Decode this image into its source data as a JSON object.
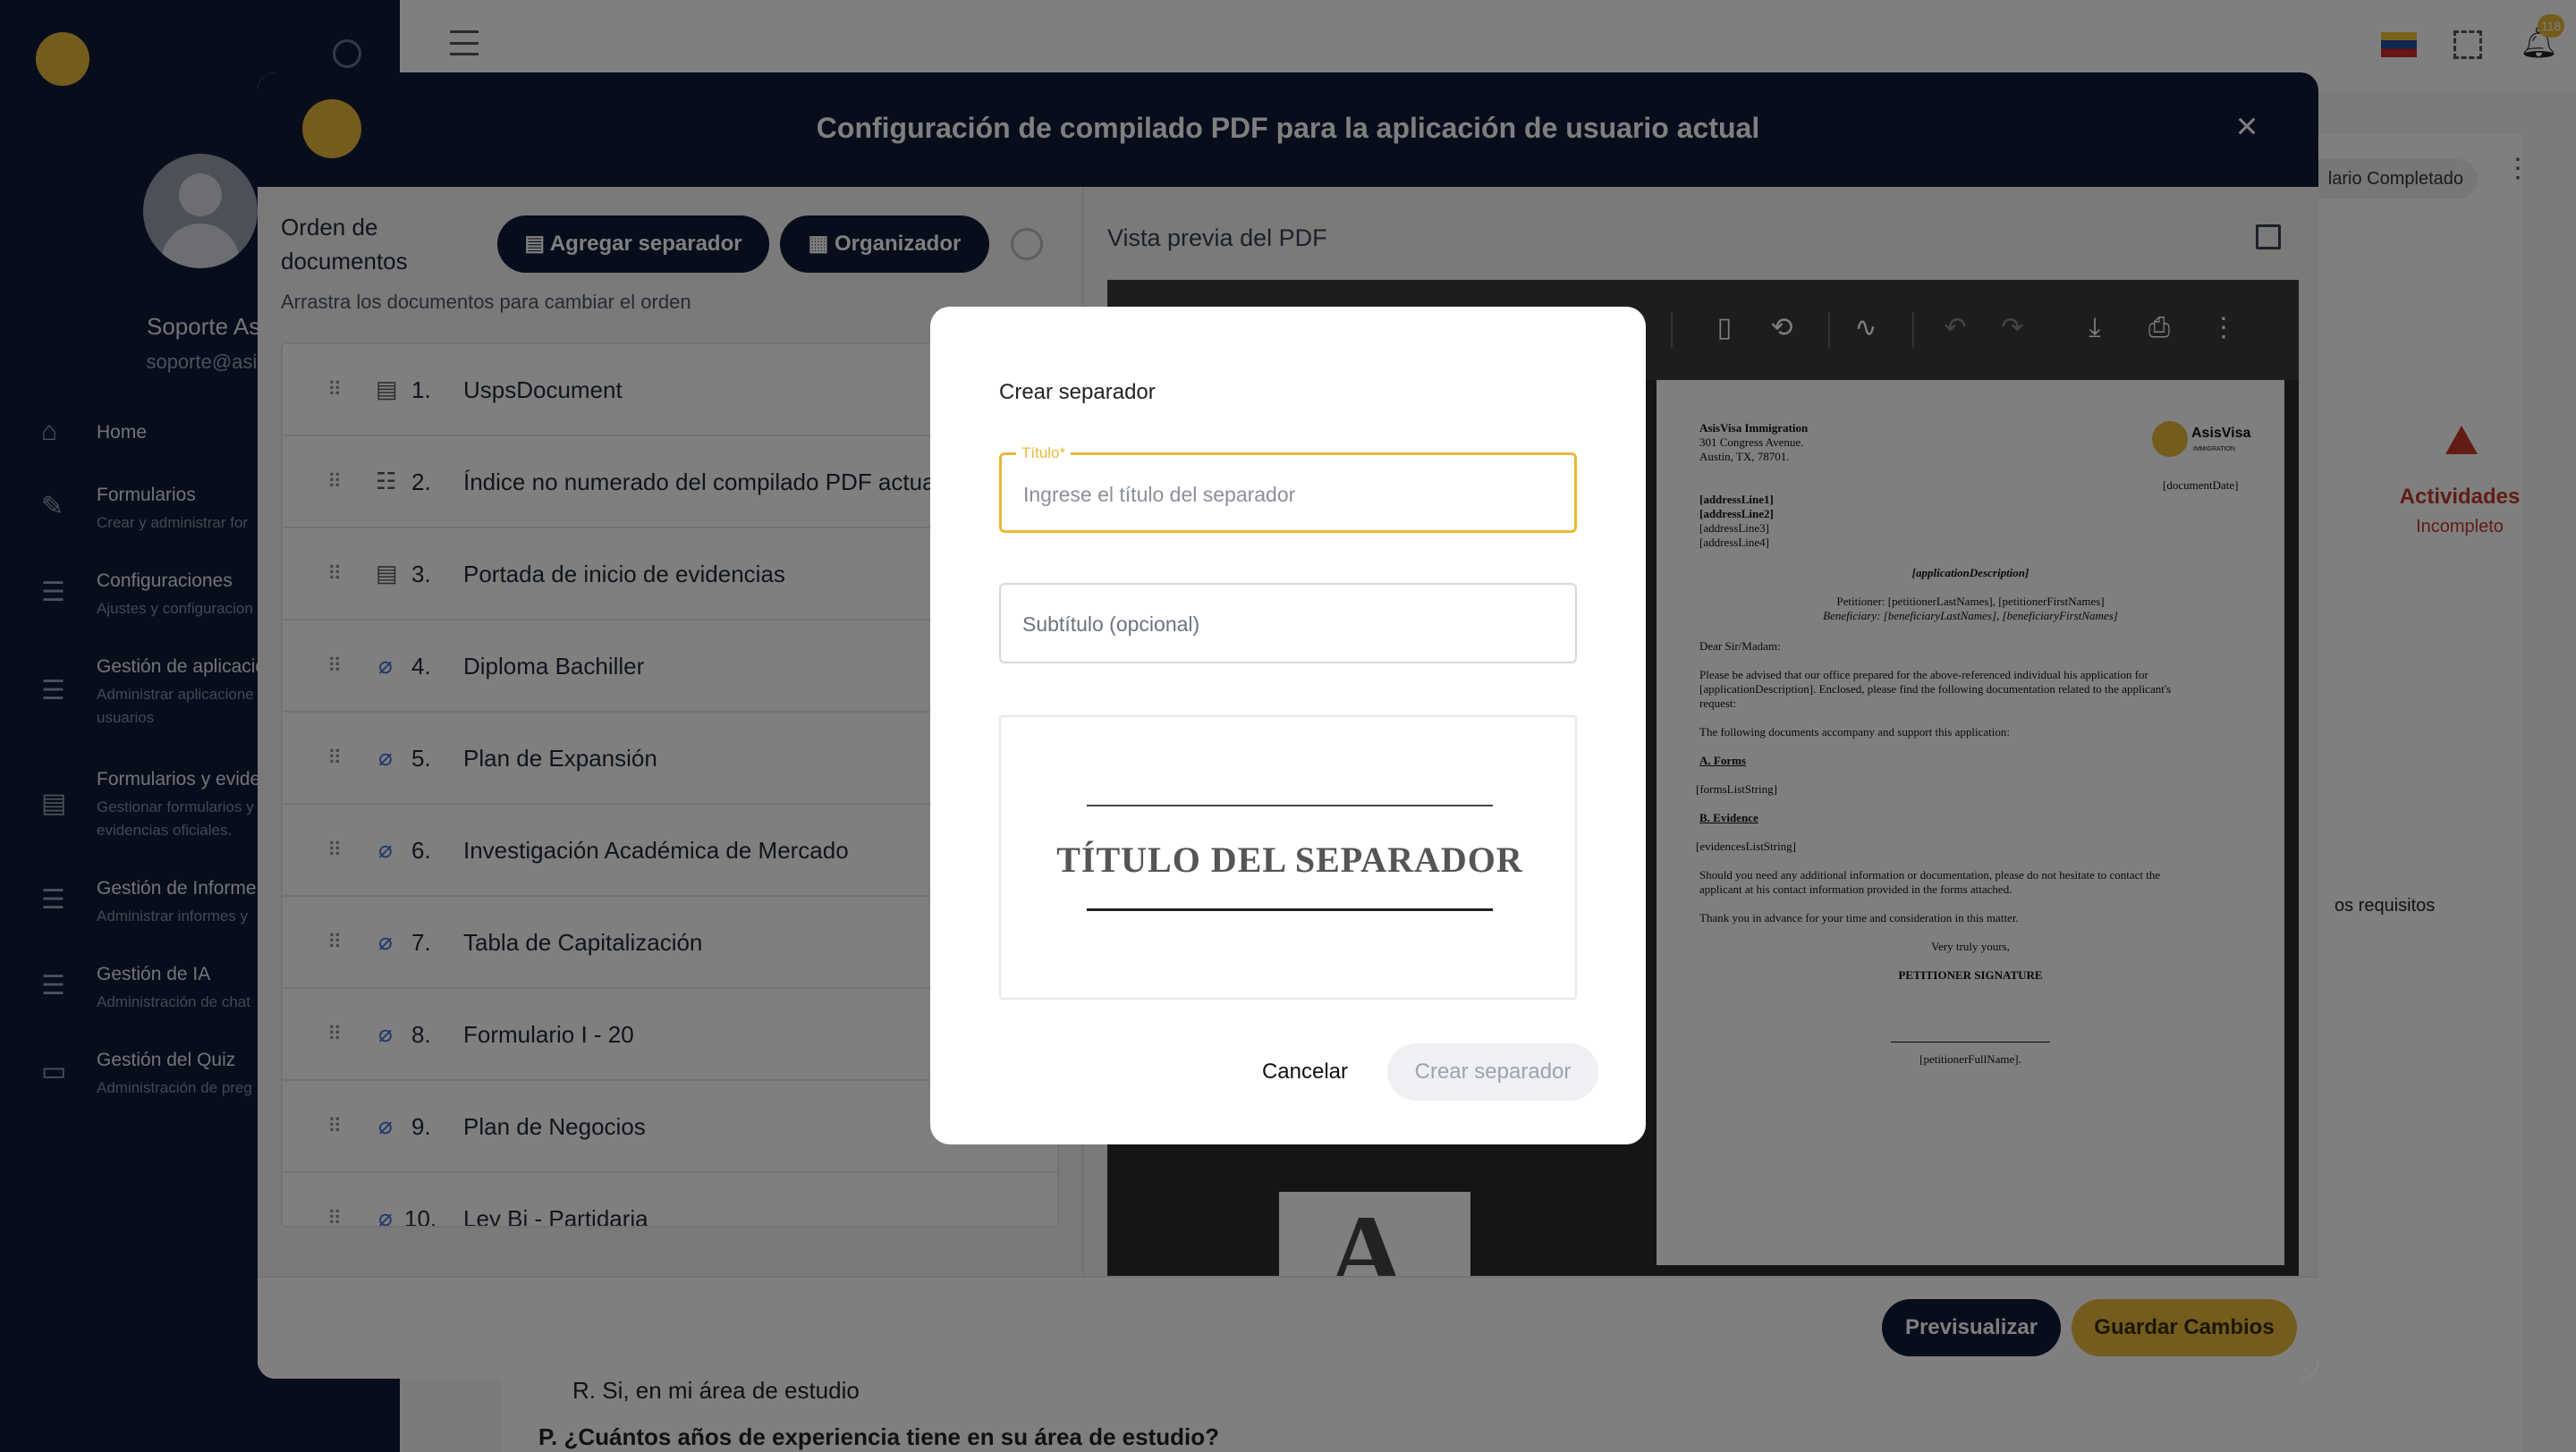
{
  "sidebar": {
    "user_name": "Soporte Asisv",
    "user_email": "soporte@asisvisa.",
    "items": [
      {
        "label": "Home",
        "sub": ""
      },
      {
        "label": "Formularios",
        "sub": "Crear y administrar for"
      },
      {
        "label": "Configuraciones",
        "sub": "Ajustes y configuracion"
      },
      {
        "label": "Gestión de aplicacio",
        "sub": "Administrar aplicacione",
        "sub2": "usuarios"
      },
      {
        "label": "Formularios y evide",
        "sub": "Gestionar formularios y",
        "sub2": "evidencias oficiales."
      },
      {
        "label": "Gestión de Informe",
        "sub": "Administrar informes y"
      },
      {
        "label": "Gestión de IA",
        "sub": "Administración de chat"
      },
      {
        "label": "Gestión del Quiz",
        "sub": "Administración de preg"
      }
    ]
  },
  "topbar": {
    "notification_count": "118"
  },
  "background": {
    "status_chip": "lario Completado",
    "activity_label": "Actividades",
    "activity_status": "Incompleto",
    "requirements_text": "os requisitos",
    "answer_text": "R. Si, en mi área de estudio",
    "question_text": "P. ¿Cuántos años de experiencia tiene en su área de estudio?"
  },
  "dialog": {
    "title": "Configuración de compilado PDF para la aplicación de usuario actual",
    "close_icon": "×",
    "left": {
      "order_title": "Orden de documentos",
      "add_separator_label": "Agregar separador",
      "organizer_label": "Organizador",
      "drag_hint": "Arrastra los documentos para cambiar el orden",
      "documents": [
        {
          "num": "1.",
          "name": "UspsDocument",
          "icon": "document-icon"
        },
        {
          "num": "2.",
          "name": "Índice no numerado del compilado PDF actual",
          "icon": "list-document-icon"
        },
        {
          "num": "3.",
          "name": "Portada de inicio de evidencias",
          "icon": "document-icon"
        },
        {
          "num": "4.",
          "name": "Diploma Bachiller",
          "icon": "attachment-icon"
        },
        {
          "num": "5.",
          "name": "Plan de Expansión",
          "icon": "attachment-icon"
        },
        {
          "num": "6.",
          "name": "Investigación Académica de Mercado",
          "icon": "attachment-icon"
        },
        {
          "num": "7.",
          "name": "Tabla de Capitalización",
          "icon": "attachment-icon"
        },
        {
          "num": "8.",
          "name": "Formulario I - 20",
          "icon": "attachment-icon"
        },
        {
          "num": "9.",
          "name": "Plan de Negocios",
          "icon": "attachment-icon"
        },
        {
          "num": "10.",
          "name": "Ley Bi - Partidaria",
          "icon": "attachment-icon"
        }
      ]
    },
    "right": {
      "preview_title": "Vista previa del PDF",
      "pdf": {
        "company": "AsisVisa Immigration",
        "addr1": "301 Congress Avenue.",
        "addr2": "Austin, TX, 78701.",
        "logo_text": "AsisVisa",
        "logo_sub": "IMMIGRATION",
        "date": "[documentDate]",
        "al1": "[addressLine1]",
        "al2": "[addressLine2]",
        "al3": "[addressLine3]",
        "al4": "[addressLine4]",
        "app_desc": "[applicationDescription]",
        "petitioner": "Petitioner: [petitionerLastNames], [petitionerFirstNames]",
        "beneficiary": "Beneficiary: [beneficiaryLastNames], [beneficiaryFirstNames]",
        "salutation": "Dear Sir/Madam:",
        "p1a": "Please be advised that our office prepared for the above-referenced individual his application for",
        "p1b": "[applicationDescription]. Enclosed, please find the following documentation related to the applicant's",
        "p1c": "request:",
        "p2": "The following documents accompany and support this application:",
        "forms_h": "A. Forms",
        "forms_list": "[formsListString]",
        "evidence_h": "B. Evidence",
        "evidence_list": "[evidencesListString]",
        "p3a": "Should you need any additional information or documentation, please do not hesitate to contact the",
        "p3b": "applicant at his contact information provided in the forms attached.",
        "p4": "Thank you in advance for your time and consideration in this matter.",
        "closing": "Very truly yours,",
        "sig": "PETITIONER SIGNATURE",
        "fullname": "[petitionerFullName].",
        "thumb_letter": "A"
      }
    },
    "footer": {
      "preview_label": "Previsualizar",
      "save_label": "Guardar Cambios"
    }
  },
  "modal": {
    "title": "Crear separador",
    "title_field_label": "Título*",
    "title_placeholder": "Ingrese el título del separador",
    "subtitle_placeholder": "Subtítulo (opcional)",
    "separator_preview_text": "TÍTULO DEL SEPARADOR",
    "cancel_label": "Cancelar",
    "create_label": "Crear separador"
  },
  "colors": {
    "navy": "#0f1a36",
    "gold": "#e8b93a",
    "danger": "#c0392b"
  }
}
